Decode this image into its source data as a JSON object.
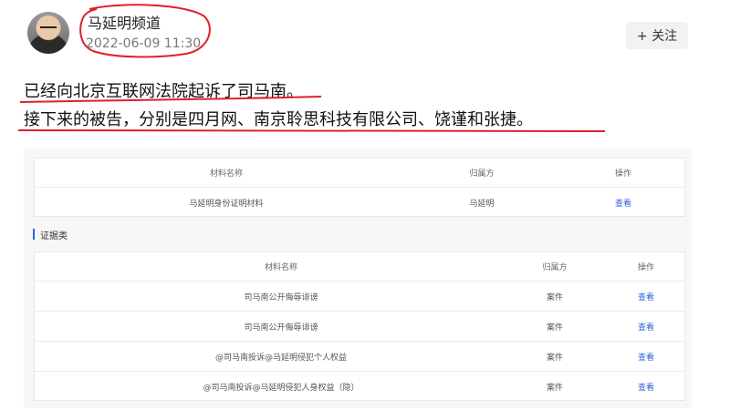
{
  "post": {
    "author": "马延明频道",
    "time": "2022-06-09 11:30",
    "follow_label": "+ 关注",
    "lines": [
      "已经向北京互联网法院起诉了司马南。",
      "接下来的被告，分别是四月网、南京聆思科技有限公司、饶谨和张捷。"
    ]
  },
  "table1": {
    "headers": [
      "材料名称",
      "归属方",
      "操作"
    ],
    "rows": [
      {
        "name": "马延明身份证明材料",
        "owner": "马延明",
        "action": "查看"
      }
    ]
  },
  "section_title": "证据类",
  "table2": {
    "headers": [
      "材料名称",
      "归属方",
      "操作"
    ],
    "rows": [
      {
        "name": "司马南公开侮辱诽谤",
        "owner": "案件",
        "action": "查看"
      },
      {
        "name": "司马南公开侮辱诽谤",
        "owner": "案件",
        "action": "查看"
      },
      {
        "name": "@司马南投诉@马延明侵犯个人权益",
        "owner": "案件",
        "action": "查看"
      },
      {
        "name": "@司马南投诉@马延明侵犯人身权益（隐）",
        "owner": "案件",
        "action": "查看"
      }
    ]
  },
  "annotation_color": "#e0202a",
  "link_color": "#2f63d1"
}
